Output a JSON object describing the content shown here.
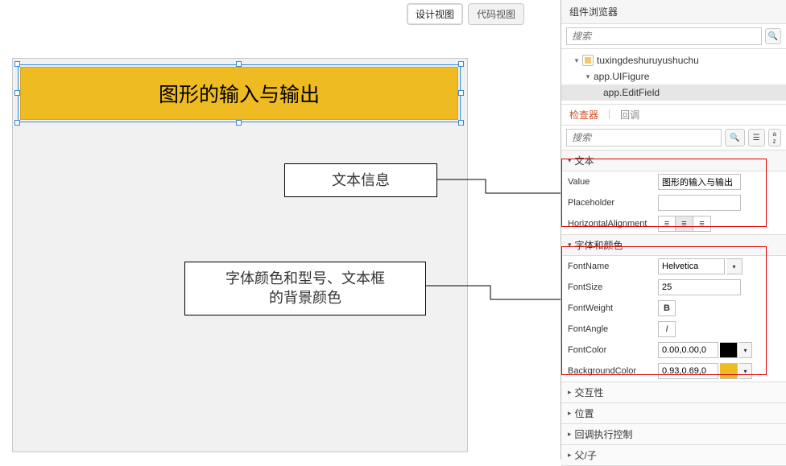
{
  "tabs": {
    "design": "设计视图",
    "code": "代码视图"
  },
  "canvas": {
    "editfield_value": "图形的输入与输出"
  },
  "callout1": "文本信息",
  "callout2_line1": "字体颜色和型号、文本框",
  "callout2_line2": "的背景颜色",
  "browser": {
    "title": "组件浏览器",
    "search_placeholder": "搜索",
    "tree": {
      "root": "tuxingdeshuruyushuchu",
      "node1": "app.UIFigure",
      "node2": "app.EditField"
    }
  },
  "inspector": {
    "tab_inspector": "检查器",
    "tab_callbacks": "回调",
    "search_placeholder": "搜索",
    "sections": {
      "text": "文本",
      "font": "字体和颜色",
      "interactivity": "交互性",
      "position": "位置",
      "callback_ctrl": "回调执行控制",
      "parent": "父/子"
    },
    "props": {
      "value_label": "Value",
      "value_val": "图形的输入与输出",
      "placeholder_label": "Placeholder",
      "placeholder_val": "",
      "halign_label": "HorizontalAlignment",
      "fontname_label": "FontName",
      "fontname_val": "Helvetica",
      "fontsize_label": "FontSize",
      "fontsize_val": "25",
      "fontweight_label": "FontWeight",
      "fontangle_label": "FontAngle",
      "fontcolor_label": "FontColor",
      "fontcolor_val": "0.00,0.00,0",
      "bgcolor_label": "BackgroundColor",
      "bgcolor_val": "0.93,0.69,0"
    }
  },
  "colors": {
    "fontcolor_swatch": "#000000",
    "bgcolor_swatch": "#eebb22"
  }
}
